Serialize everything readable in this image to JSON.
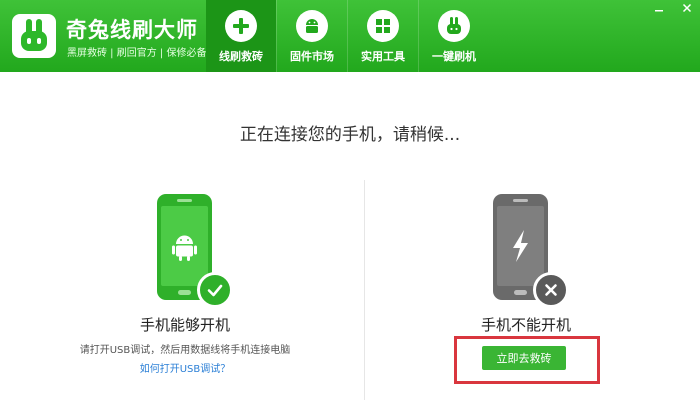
{
  "header": {
    "brand_title": "奇兔线刷大师",
    "brand_subtitle": "黑屏救砖 | 刷回官方 | 保修必备",
    "nav": [
      {
        "label": "线刷救砖",
        "icon": "plus-icon",
        "active": true
      },
      {
        "label": "固件市场",
        "icon": "android-icon",
        "active": false
      },
      {
        "label": "实用工具",
        "icon": "grid-icon",
        "active": false
      },
      {
        "label": "一键刷机",
        "icon": "rabbit-icon",
        "active": false
      }
    ]
  },
  "main": {
    "status_title": "正在连接您的手机，请稍候...",
    "left": {
      "caption": "手机能够开机",
      "hint": "请打开USB调试，然后用数据线将手机连接电脑",
      "link": "如何打开USB调试？"
    },
    "right": {
      "caption": "手机不能开机",
      "button": "立即去救砖"
    }
  },
  "colors": {
    "brand_green": "#22a81d",
    "button_green": "#3ab534",
    "phone_gray": "#707070",
    "highlight_red": "#d9363e",
    "link_blue": "#2b7fd6"
  }
}
